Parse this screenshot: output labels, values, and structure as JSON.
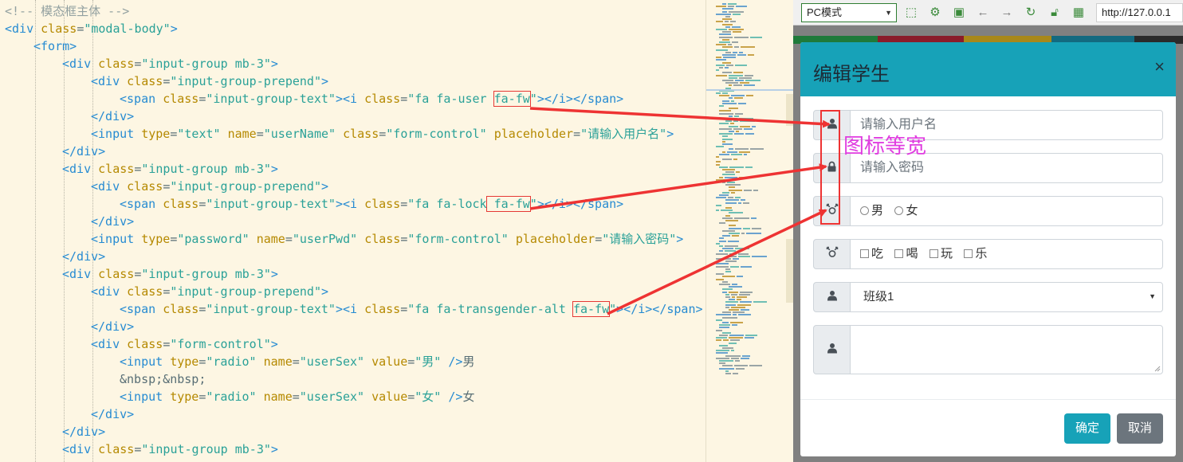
{
  "editor": {
    "lines": [
      {
        "indent": 0,
        "tokens": [
          [
            "comment",
            "<!-- 模态框主体 -->"
          ]
        ]
      },
      {
        "indent": 0,
        "tokens": [
          [
            "tag",
            "<div "
          ],
          [
            "attr",
            "class"
          ],
          [
            "plain",
            "="
          ],
          [
            "str",
            "\"modal-body\""
          ],
          [
            "tag",
            ">"
          ]
        ]
      },
      {
        "indent": 1,
        "tokens": [
          [
            "tag",
            "<form>"
          ]
        ]
      },
      {
        "indent": 2,
        "tokens": [
          [
            "tag",
            "<div "
          ],
          [
            "attr",
            "class"
          ],
          [
            "plain",
            "="
          ],
          [
            "str",
            "\"input-group mb-3\""
          ],
          [
            "tag",
            ">"
          ]
        ]
      },
      {
        "indent": 3,
        "tokens": [
          [
            "tag",
            "<div "
          ],
          [
            "attr",
            "class"
          ],
          [
            "plain",
            "="
          ],
          [
            "str",
            "\"input-group-prepend\""
          ],
          [
            "tag",
            ">"
          ]
        ]
      },
      {
        "indent": 4,
        "tokens": [
          [
            "tag",
            "<span "
          ],
          [
            "attr",
            "class"
          ],
          [
            "plain",
            "="
          ],
          [
            "str",
            "\"input-group-text\""
          ],
          [
            "tag",
            "><i "
          ],
          [
            "attr",
            "class"
          ],
          [
            "plain",
            "="
          ],
          [
            "str",
            "\"fa fa-user "
          ],
          [
            "strbox",
            "fa-fw"
          ],
          [
            "str",
            "\""
          ],
          [
            "tag",
            "></i></span>"
          ]
        ]
      },
      {
        "indent": 3,
        "tokens": [
          [
            "tag",
            "</div>"
          ]
        ]
      },
      {
        "indent": 3,
        "tokens": [
          [
            "tag",
            "<input "
          ],
          [
            "attr",
            "type"
          ],
          [
            "plain",
            "="
          ],
          [
            "str",
            "\"text\" "
          ],
          [
            "attr",
            "name"
          ],
          [
            "plain",
            "="
          ],
          [
            "str",
            "\"userName\" "
          ],
          [
            "attr",
            "class"
          ],
          [
            "plain",
            "="
          ],
          [
            "str",
            "\"form-control\" "
          ],
          [
            "attr",
            "placeholder"
          ],
          [
            "plain",
            "="
          ],
          [
            "str",
            "\"请输入用户名\""
          ],
          [
            "tag",
            ">"
          ]
        ]
      },
      {
        "indent": 2,
        "tokens": [
          [
            "tag",
            "</div>"
          ]
        ]
      },
      {
        "indent": 2,
        "tokens": [
          [
            "tag",
            "<div "
          ],
          [
            "attr",
            "class"
          ],
          [
            "plain",
            "="
          ],
          [
            "str",
            "\"input-group mb-3\""
          ],
          [
            "tag",
            ">"
          ]
        ]
      },
      {
        "indent": 3,
        "tokens": [
          [
            "tag",
            "<div "
          ],
          [
            "attr",
            "class"
          ],
          [
            "plain",
            "="
          ],
          [
            "str",
            "\"input-group-prepend\""
          ],
          [
            "tag",
            ">"
          ]
        ]
      },
      {
        "indent": 4,
        "tokens": [
          [
            "tag",
            "<span "
          ],
          [
            "attr",
            "class"
          ],
          [
            "plain",
            "="
          ],
          [
            "str",
            "\"input-group-text\""
          ],
          [
            "tag",
            "><i "
          ],
          [
            "attr",
            "class"
          ],
          [
            "plain",
            "="
          ],
          [
            "str",
            "\"fa fa-lock"
          ],
          [
            "strbox",
            " fa-fw"
          ],
          [
            "str",
            "\""
          ],
          [
            "tag",
            "></i></span>"
          ]
        ]
      },
      {
        "indent": 3,
        "tokens": [
          [
            "tag",
            "</div>"
          ]
        ]
      },
      {
        "indent": 3,
        "tokens": [
          [
            "tag",
            "<input "
          ],
          [
            "attr",
            "type"
          ],
          [
            "plain",
            "="
          ],
          [
            "str",
            "\"password\" "
          ],
          [
            "attr",
            "name"
          ],
          [
            "plain",
            "="
          ],
          [
            "str",
            "\"userPwd\" "
          ],
          [
            "attr",
            "class"
          ],
          [
            "plain",
            "="
          ],
          [
            "str",
            "\"form-control\" "
          ],
          [
            "attr",
            "placeholder"
          ],
          [
            "plain",
            "="
          ],
          [
            "str",
            "\"请输入密码\""
          ],
          [
            "tag",
            ">"
          ]
        ]
      },
      {
        "indent": 2,
        "tokens": [
          [
            "tag",
            "</div>"
          ]
        ]
      },
      {
        "indent": 2,
        "tokens": [
          [
            "tag",
            "<div "
          ],
          [
            "attr",
            "class"
          ],
          [
            "plain",
            "="
          ],
          [
            "str",
            "\"input-group mb-3\""
          ],
          [
            "tag",
            ">"
          ]
        ]
      },
      {
        "indent": 3,
        "tokens": [
          [
            "tag",
            "<div "
          ],
          [
            "attr",
            "class"
          ],
          [
            "plain",
            "="
          ],
          [
            "str",
            "\"input-group-prepend\""
          ],
          [
            "tag",
            ">"
          ]
        ]
      },
      {
        "indent": 4,
        "tokens": [
          [
            "tag",
            "<span "
          ],
          [
            "attr",
            "class"
          ],
          [
            "plain",
            "="
          ],
          [
            "str",
            "\"input-group-text\""
          ],
          [
            "tag",
            "><i "
          ],
          [
            "attr",
            "class"
          ],
          [
            "plain",
            "="
          ],
          [
            "str",
            "\"fa fa-transgender-alt "
          ],
          [
            "strbox",
            "fa-fw"
          ],
          [
            "str",
            "\""
          ],
          [
            "tag",
            "></i></span>"
          ]
        ]
      },
      {
        "indent": 3,
        "tokens": [
          [
            "tag",
            "</div>"
          ]
        ]
      },
      {
        "indent": 3,
        "tokens": [
          [
            "tag",
            "<div "
          ],
          [
            "attr",
            "class"
          ],
          [
            "plain",
            "="
          ],
          [
            "str",
            "\"form-control\""
          ],
          [
            "tag",
            ">"
          ]
        ]
      },
      {
        "indent": 4,
        "tokens": [
          [
            "tag",
            "<input "
          ],
          [
            "attr",
            "type"
          ],
          [
            "plain",
            "="
          ],
          [
            "str",
            "\"radio\" "
          ],
          [
            "attr",
            "name"
          ],
          [
            "plain",
            "="
          ],
          [
            "str",
            "\"userSex\" "
          ],
          [
            "attr",
            "value"
          ],
          [
            "plain",
            "="
          ],
          [
            "str",
            "\"男\" "
          ],
          [
            "tag",
            "/>"
          ],
          [
            "plain",
            "男"
          ]
        ]
      },
      {
        "indent": 4,
        "tokens": [
          [
            "plain",
            "&nbsp;&nbsp;"
          ]
        ]
      },
      {
        "indent": 4,
        "tokens": [
          [
            "tag",
            "<input "
          ],
          [
            "attr",
            "type"
          ],
          [
            "plain",
            "="
          ],
          [
            "str",
            "\"radio\" "
          ],
          [
            "attr",
            "name"
          ],
          [
            "plain",
            "="
          ],
          [
            "str",
            "\"userSex\" "
          ],
          [
            "attr",
            "value"
          ],
          [
            "plain",
            "="
          ],
          [
            "str",
            "\"女\" "
          ],
          [
            "tag",
            "/>"
          ],
          [
            "plain",
            "女"
          ]
        ]
      },
      {
        "indent": 3,
        "tokens": [
          [
            "tag",
            "</div>"
          ]
        ]
      },
      {
        "indent": 2,
        "tokens": [
          [
            "tag",
            "</div>"
          ]
        ]
      },
      {
        "indent": 2,
        "tokens": [
          [
            "tag",
            "<div "
          ],
          [
            "attr",
            "class"
          ],
          [
            "plain",
            "="
          ],
          [
            "str",
            "\"input-group mb-3\""
          ],
          [
            "tag",
            ">"
          ]
        ]
      }
    ]
  },
  "browser": {
    "mode_select": "PC模式",
    "url": "http://127.0.0.1",
    "toolbar_icons": [
      "restore-window-icon",
      "settings-icon",
      "console-icon",
      "back-arrow-icon",
      "forward-arrow-icon",
      "refresh-icon",
      "lock-icon",
      "qrcode-icon"
    ]
  },
  "modal": {
    "title": "编辑学生",
    "close": "×",
    "username_placeholder": "请输入用户名",
    "password_placeholder": "请输入密码",
    "sex_options": [
      "男",
      "女"
    ],
    "hobby_options": [
      "吃",
      "喝",
      "玩",
      "乐"
    ],
    "class_value": "班级1",
    "ok_label": "确定",
    "cancel_label": "取消"
  },
  "annotation": {
    "label": "图标等宽",
    "color": "#e03de0",
    "arrow_color": "#ee3333"
  }
}
